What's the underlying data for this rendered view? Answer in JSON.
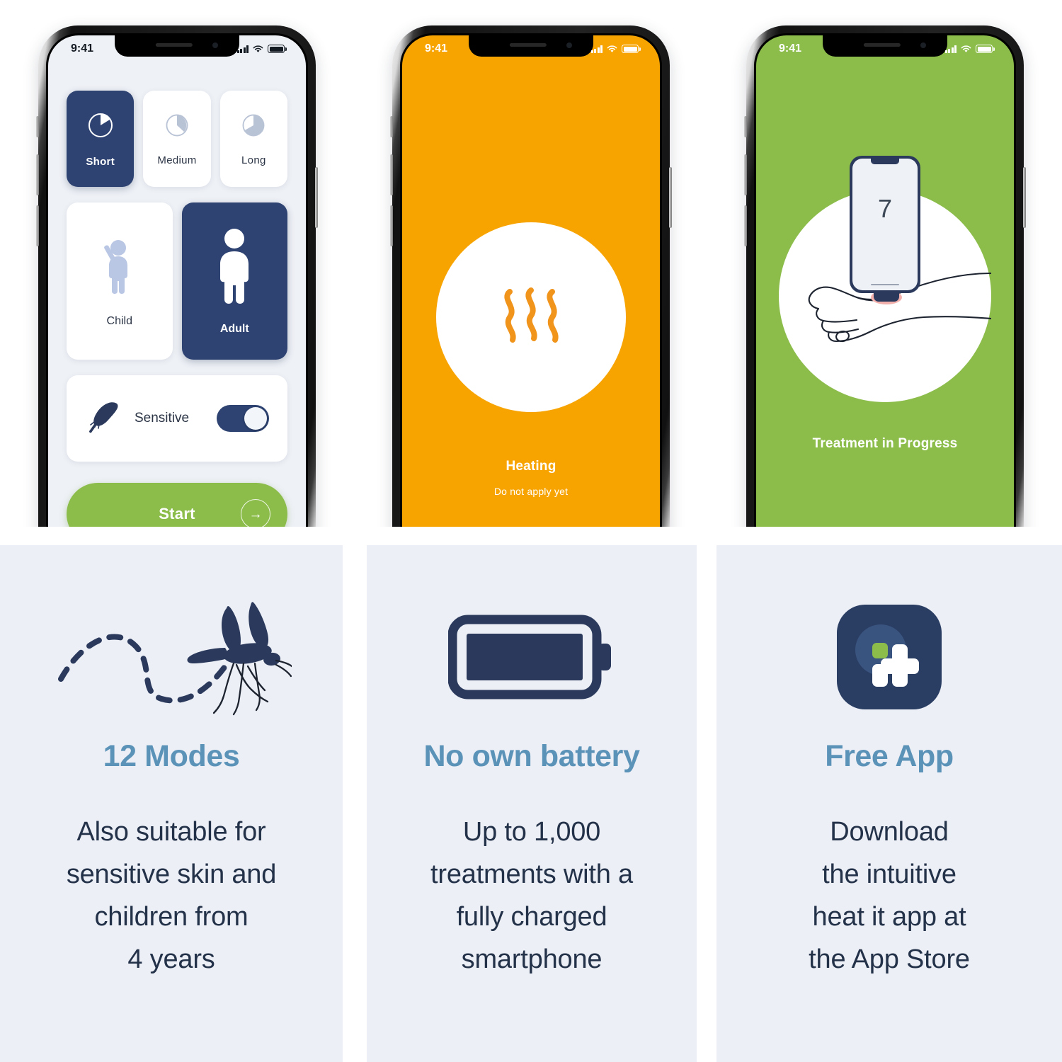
{
  "phones": [
    {
      "id": "settings-screen",
      "status_bar": {
        "time": "9:41",
        "signal_icon": "cellular-bars-icon",
        "wifi_icon": "wifi-icon",
        "battery_icon": "battery-icon"
      },
      "modes": {
        "label": "duration-modes",
        "options": [
          "Short",
          "Medium",
          "Long"
        ],
        "selected": "Short"
      },
      "age_groups": {
        "options": [
          "Child",
          "Adult"
        ],
        "selected": "Adult"
      },
      "sensitive": {
        "label": "Sensitive",
        "icon": "feather-icon",
        "enabled": true
      },
      "start_button": {
        "label": "Start",
        "icon": "arrow-right-icon"
      }
    },
    {
      "id": "heating-screen",
      "status_bar": {
        "time": "9:41",
        "signal_icon": "cellular-bars-icon",
        "wifi_icon": "wifi-icon",
        "battery_icon": "battery-icon"
      },
      "icon": "heat-waves-icon",
      "caption": "Heating",
      "subcaption": "Do not apply yet"
    },
    {
      "id": "treatment-screen",
      "status_bar": {
        "time": "9:41",
        "signal_icon": "cellular-bars-icon",
        "wifi_icon": "wifi-icon",
        "battery_icon": "battery-icon"
      },
      "countdown": "7",
      "illustration": "hand-with-device-icon",
      "caption": "Treatment in Progress"
    }
  ],
  "features": [
    {
      "icon": "mosquito-icon",
      "title": "12 Modes",
      "body": "Also suitable for\nsensitive skin and\nchildren from\n4 years"
    },
    {
      "icon": "battery-full-icon",
      "title": "No own battery",
      "body": "Up to 1,000\ntreatments with a\nfully charged\nsmartphone"
    },
    {
      "icon": "heat-it-app-icon",
      "title": "Free App",
      "body": "Download\nthe intuitive\nheat it app at\nthe App Store"
    }
  ],
  "colors": {
    "navy": "#2e4372",
    "green": "#8cbd4b",
    "orange": "#f8a400",
    "panel_bg": "#eceff6",
    "title_blue": "#5b92b8",
    "body_text": "#243249"
  }
}
